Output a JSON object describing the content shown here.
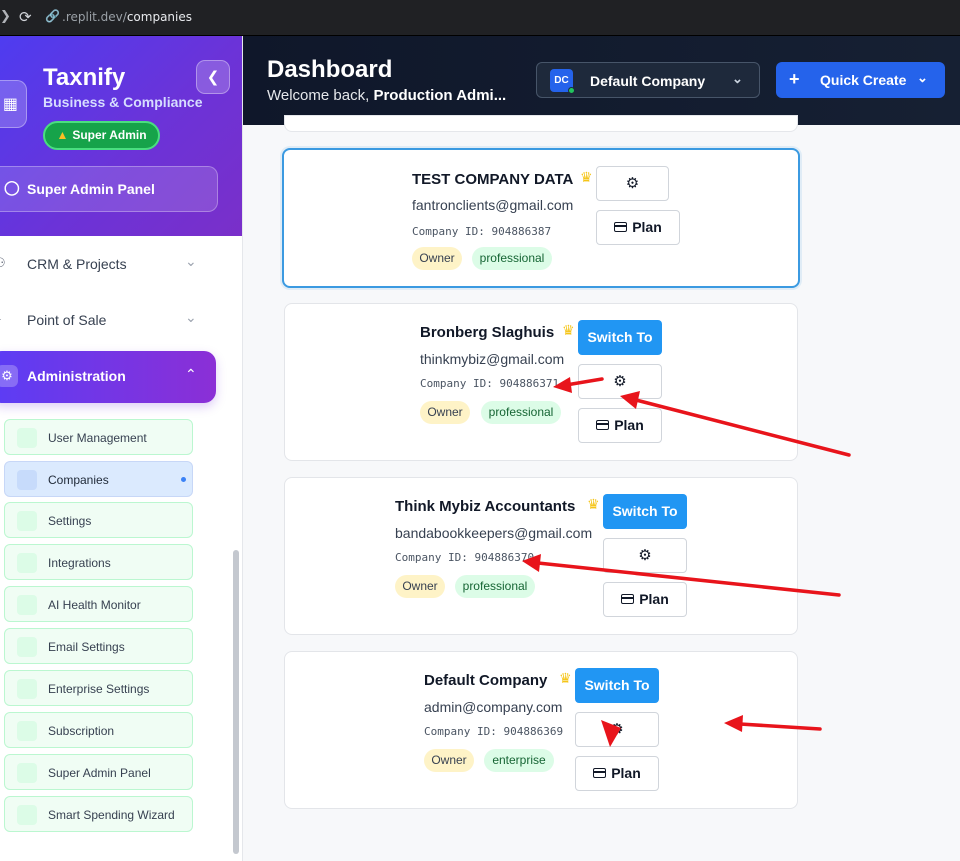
{
  "browser": {
    "url_host": ".replit.dev/",
    "url_path": "companies"
  },
  "sidebar": {
    "brand": "Taxnify",
    "brand_subtitle": "Business & Compliance",
    "role_badge": "Super Admin",
    "panel_button": "Super Admin Panel",
    "nav": [
      {
        "label": "CRM & Projects",
        "icon": "users-icon"
      },
      {
        "label": "Point of Sale",
        "icon": "pos-icon"
      },
      {
        "label": "Administration",
        "icon": "gear-icon",
        "active": true
      }
    ],
    "sub_items": [
      {
        "label": "User Management"
      },
      {
        "label": "Companies",
        "active": true
      },
      {
        "label": "Settings"
      },
      {
        "label": "Integrations"
      },
      {
        "label": "AI Health Monitor"
      },
      {
        "label": "Email Settings"
      },
      {
        "label": "Enterprise Settings"
      },
      {
        "label": "Subscription"
      },
      {
        "label": "Super Admin Panel"
      },
      {
        "label": "Smart Spending Wizard"
      }
    ]
  },
  "header": {
    "title": "Dashboard",
    "welcome_prefix": "Welcome back, ",
    "welcome_name": "Production Admi...",
    "company_initials": "DC",
    "company_name": "Default Company",
    "quick_create": "Quick Create"
  },
  "companies": [
    {
      "name": "TEST COMPANY DATA",
      "email": "fantronclients@gmail.com",
      "company_id": "Company ID: 904886387",
      "role": "Owner",
      "plan": "professional",
      "selected": true,
      "switch_label": null,
      "plan_button": "Plan"
    },
    {
      "name": "Bronberg Slaghuis",
      "email": "thinkmybiz@gmail.com",
      "company_id": "Company ID: 904886371",
      "role": "Owner",
      "plan": "professional",
      "switch_label": "Switch To",
      "plan_button": "Plan"
    },
    {
      "name": "Think Mybiz Accountants",
      "email": "bandabookkeepers@gmail.com",
      "company_id": "Company ID: 904886370",
      "role": "Owner",
      "plan": "professional",
      "switch_label": "Switch To",
      "plan_button": "Plan"
    },
    {
      "name": "Default Company",
      "email": "admin@company.com",
      "company_id": "Company ID: 904886369",
      "role": "Owner",
      "plan": "enterprise",
      "switch_label": "Switch To",
      "plan_button": "Plan"
    }
  ],
  "colors": {
    "accent": "#2196f3",
    "annotation_arrow": "#e8141b"
  }
}
